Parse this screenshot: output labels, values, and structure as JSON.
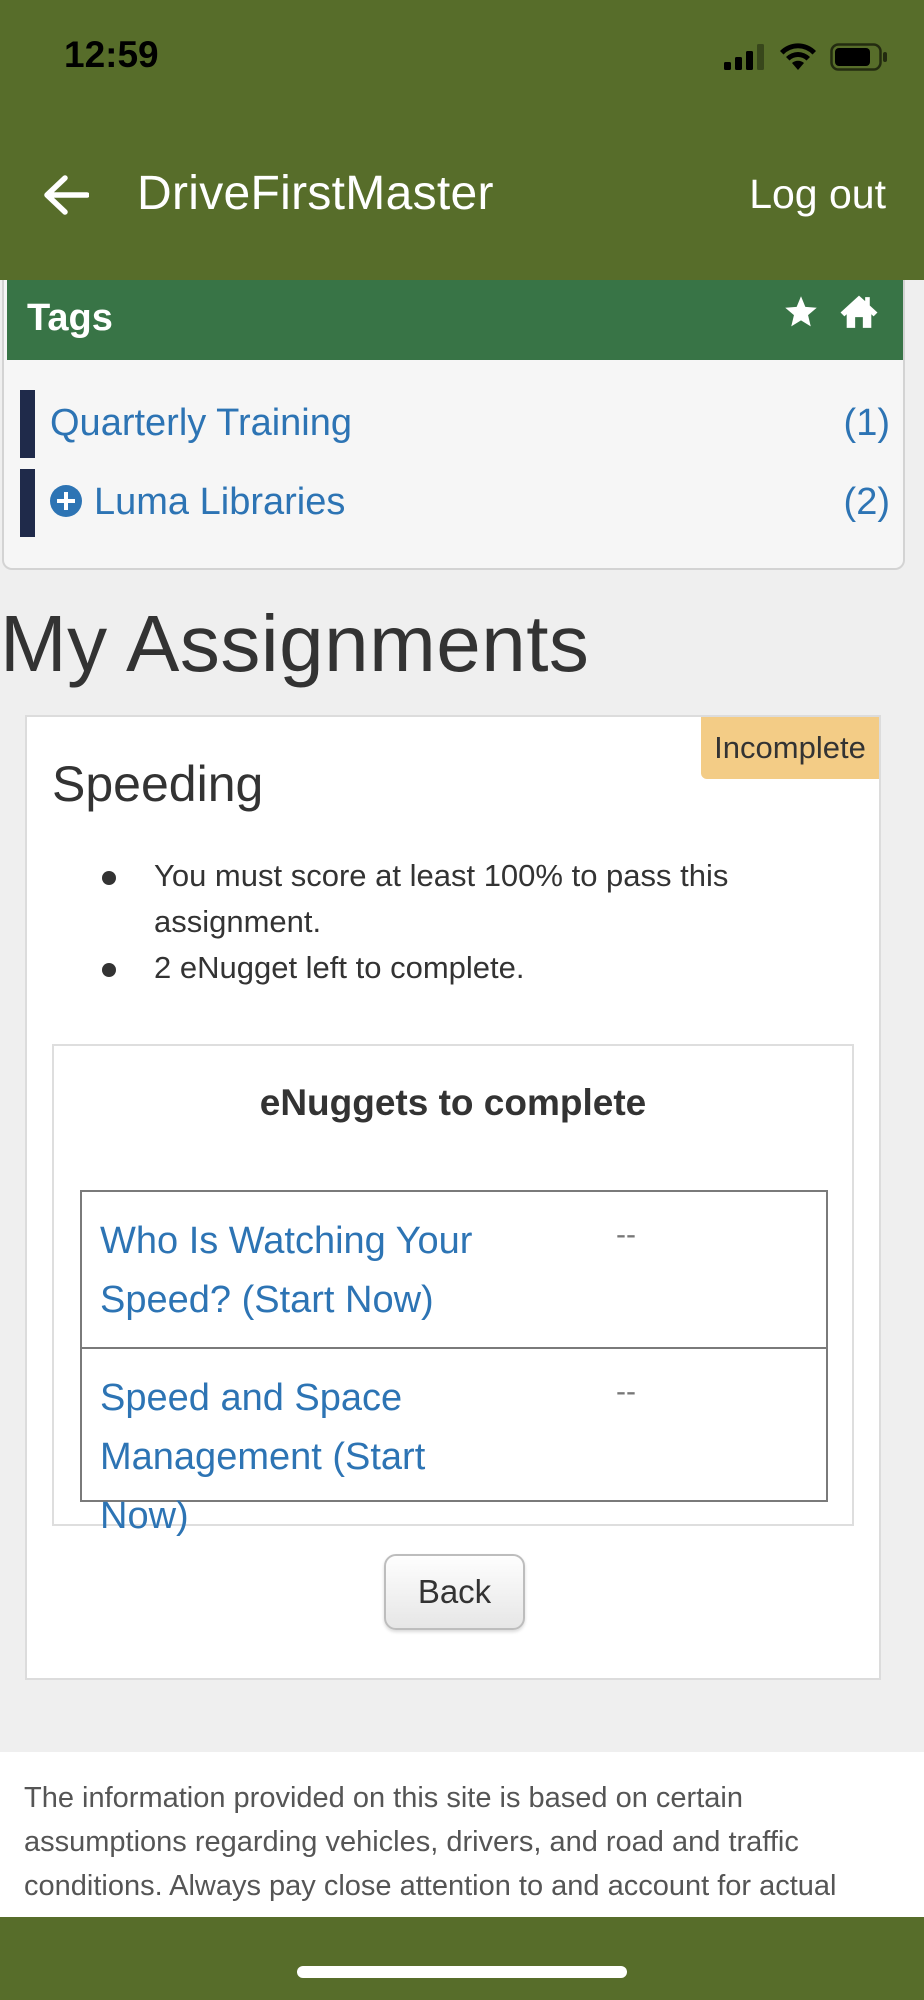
{
  "status_bar": {
    "time": "12:59",
    "icons": [
      "signal-icon",
      "wifi-icon",
      "battery-icon"
    ]
  },
  "header": {
    "back_icon": "arrow-left-icon",
    "title": "DriveFirstMaster",
    "logout_label": "Log out",
    "background_color": "#576d2a"
  },
  "tags": {
    "title": "Tags",
    "icons": [
      "star-icon",
      "home-icon"
    ],
    "header_color": "#387446",
    "items": [
      {
        "label": "Quarterly Training",
        "count": "(1)",
        "expandable": false
      },
      {
        "label": "Luma Libraries",
        "count": "(2)",
        "expandable": true
      }
    ]
  },
  "page_title": "My Assignments",
  "assignment": {
    "title": "Speeding",
    "status_badge": "Incomplete",
    "badge_color": "#f3cc86",
    "bullets": [
      "You must score at least 100% to pass this assignment.",
      "2 eNugget left to complete."
    ],
    "enuggets": {
      "heading": "eNuggets to complete",
      "rows": [
        {
          "title": "Who Is Watching Your Speed? (Start Now)",
          "status": "--"
        },
        {
          "title": "Speed and Space Management (Start Now)",
          "status": "--"
        }
      ]
    },
    "back_label": "Back"
  },
  "footer": {
    "text": "The information provided on this site is based on certain assumptions regarding vehicles, drivers, and road and traffic conditions. Always pay close attention to and account for actual"
  }
}
